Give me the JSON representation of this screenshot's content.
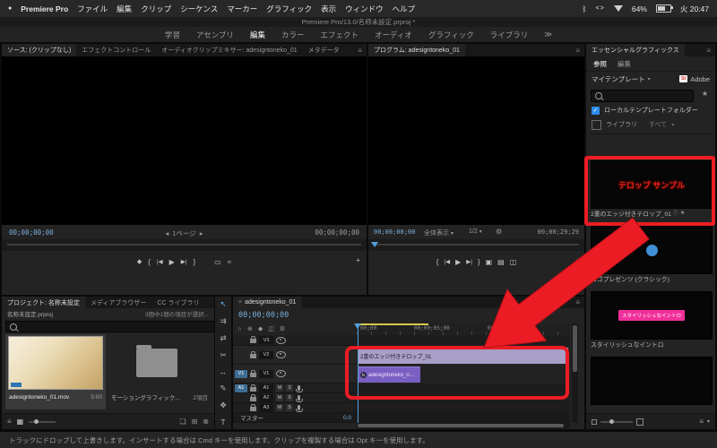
{
  "icons": {
    "apple": "●",
    "bluetooth": "ᛒ",
    "brackets": "<>",
    "menu": "≡",
    "close": "×",
    "caret_down": "▾",
    "caret_left": "◂",
    "caret_right": "▸",
    "double_caret": "≫",
    "star": "★",
    "check": "✓",
    "info": "ⓘ",
    "marker": "◆",
    "mark_in": "{",
    "mark_out": "}",
    "step_back": "|◀",
    "play": "▶",
    "step_fwd": "▶|",
    "lift": "▣",
    "extract": "▤",
    "export_frame": "◫",
    "plus": "+",
    "gear": "⚙",
    "drag_video": "▭",
    "drag_audio": "≈",
    "snap": "∩",
    "linked": "⊕",
    "list_view": "≡",
    "thumb_view": "▦",
    "bin": "❏",
    "new_item": "⊞",
    "trash": "⊗"
  },
  "menubar": {
    "app_name": "Premiere Pro",
    "items": [
      "ファイル",
      "編集",
      "クリップ",
      "シーケンス",
      "マーカー",
      "グラフィック",
      "表示",
      "ウィンドウ",
      "ヘルプ"
    ],
    "battery": "64%",
    "clock": "火 20:47"
  },
  "titlebar": {
    "title": "Premiere Pro/13.0/名称未設定.prproj *"
  },
  "workspaces": {
    "tabs": [
      "学習",
      "アセンブリ",
      "編集",
      "カラー",
      "エフェクト",
      "オーディオ",
      "グラフィック",
      "ライブラリ"
    ]
  },
  "source": {
    "tabs": [
      "ソース: (クリップなし)",
      "エフェクトコントロール",
      "オーディオクリップミキサー: adesigntoneko_01",
      "メタデータ"
    ],
    "tc_left": "00;00;00;00",
    "page": "1ページ",
    "tc_right": "00;00;00;00"
  },
  "program": {
    "title": "プログラム: adesigntoneko_01",
    "tc_left": "00;00;00;00",
    "fit": "全体表示",
    "zoom": "1/2",
    "tc_right": "00;00;29;29"
  },
  "essential_graphics": {
    "title": "エッセンシャルグラフィックス",
    "tab_browse": "参照",
    "tab_edit": "編集",
    "library": "マイテンプレート",
    "stock_badge": "St",
    "stock_label": "Adobe",
    "cb_local": "ローカルテンプレートフォルダー",
    "cb_library": "ライブラリ",
    "cb_library_value": "すべて",
    "templates": [
      {
        "name": "2重のエッジ付きテロップ_01",
        "thumb_text": "テロップ サンプル"
      },
      {
        "name": "ロゴプレゼンツ (クラシック)"
      },
      {
        "name": "スタイリッシュなイントロ",
        "thumb_text": "スタイリッシュなイントロ"
      }
    ]
  },
  "project": {
    "tab_project": "プロジェクト: 名称未設定",
    "tab_media": "メディアブラウザー",
    "tab_cc": "CC ライブラリ",
    "file": "名称未設定.prproj",
    "selection": "3個中1個の項目が選択...",
    "items": [
      {
        "label": "adesigntoneko_01.mov",
        "meta": "5:00"
      },
      {
        "label": "モーショングラフィック...",
        "meta": "2項目"
      }
    ]
  },
  "tools": [
    {
      "name": "selection-tool",
      "glyph": "↖"
    },
    {
      "name": "track-select-tool",
      "glyph": "⇉"
    },
    {
      "name": "ripple-edit-tool",
      "glyph": "⇄"
    },
    {
      "name": "razor-tool",
      "glyph": "✂"
    },
    {
      "name": "slip-tool",
      "glyph": "↔"
    },
    {
      "name": "pen-tool",
      "glyph": "✎"
    },
    {
      "name": "hand-tool",
      "glyph": "✥"
    },
    {
      "name": "type-tool",
      "glyph": "T"
    }
  ],
  "timeline": {
    "tab": "adesigntoneko_01",
    "timecode": "00;00;00;00",
    "ruler": [
      "00;00",
      "00;00;05;00",
      "00;00;10;00"
    ],
    "tracks": {
      "v": [
        "V3",
        "V2",
        "V1"
      ],
      "a": [
        "A1",
        "A2",
        "A3"
      ]
    },
    "patch_video": "V1",
    "patch_audio": "A1",
    "mute": "M",
    "solo": "S",
    "master_label": "マスター",
    "master_level": "0.0",
    "clips": {
      "graphic": {
        "label": "2重のエッジ付きテロップ_01"
      },
      "video": {
        "label": "adesigntoneko_01.mov",
        "badge": "fx"
      }
    }
  },
  "statusbar": {
    "text": "トラックにドロップして上書きします。インサートする場合は Cmd キーを使用します。クリップを複製する場合は Opt キーを使用します。"
  }
}
